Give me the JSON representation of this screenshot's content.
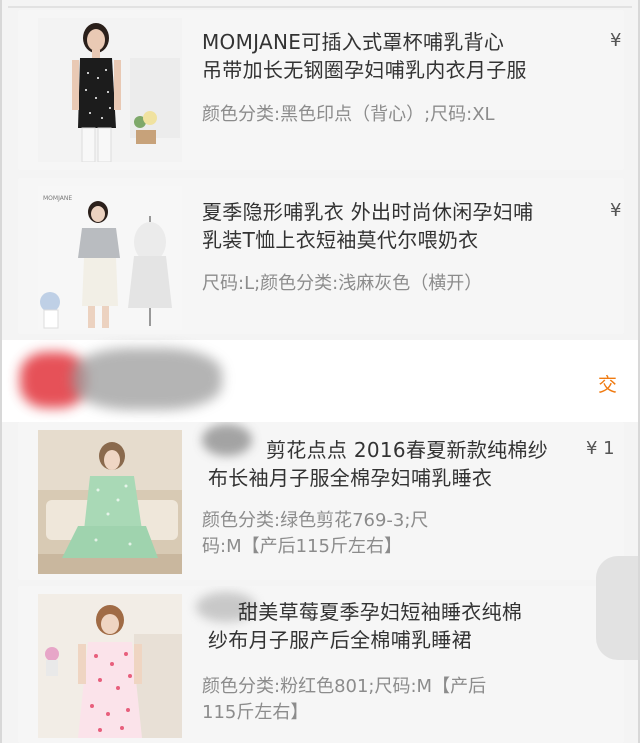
{
  "orders": [
    {
      "title_line1": "MOMJANE可插入式罩杯哺乳背心",
      "title_line2": "吊带加长无钢圈孕妇哺乳内衣月子服",
      "spec_line1": "颜色分类:黑色印点（背心）;尺码:XL",
      "spec_line2": "",
      "price": "¥"
    },
    {
      "title_line1": "夏季隐形哺乳衣 外出时尚休闲孕妇哺",
      "title_line2": "乳装T恤上衣短袖莫代尔喂奶衣",
      "spec_line1": "尺码:L;颜色分类:浅麻灰色（横开）",
      "spec_line2": "",
      "price": "¥"
    },
    {
      "title_line1": "剪花点点 2016春夏新款纯棉纱",
      "title_line2": "布长袖月子服全棉孕妇哺乳睡衣",
      "spec_line1": "颜色分类:绿色剪花769-3;尺",
      "spec_line2": "码:M【产后115斤左右】",
      "price": "¥ 1"
    },
    {
      "title_line1": "甜美草莓夏季孕妇短袖睡衣纯棉",
      "title_line2": "纱布月子服产后全棉哺乳睡裙",
      "spec_line1": "颜色分类:粉红色801;尺码:M【产后",
      "spec_line2": "115斤左右】",
      "price": "¥"
    }
  ],
  "store_group": {
    "status": "交"
  },
  "thumb_brand": "MOMJANE",
  "colors": {
    "status_orange": "#f07a10",
    "card_bg": "#f6f6f6",
    "title_text": "#333333",
    "spec_text": "#8c8c8c"
  }
}
